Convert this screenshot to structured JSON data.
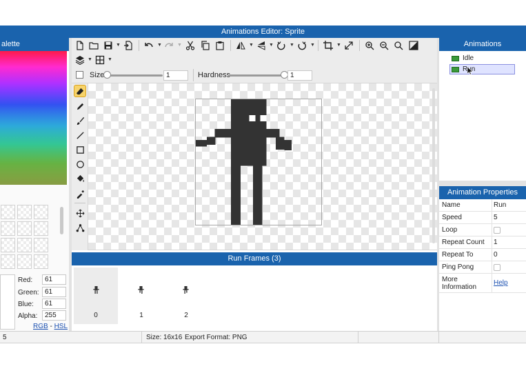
{
  "window": {
    "title": "Animations Editor: Sprite"
  },
  "palette": {
    "title": "alette",
    "red_label": "Red:",
    "red": "61",
    "green_label": "Green:",
    "green": "61",
    "blue_label": "Blue:",
    "blue": "61",
    "alpha_label": "Alpha:",
    "alpha": "255",
    "mode_rgb": "RGB",
    "mode_sep": "-",
    "mode_hsl": "HSL"
  },
  "toolbar": {
    "size_label": "Size",
    "size_value": "1",
    "size_level": 0.0,
    "hardness_label": "Hardness",
    "hardness_value": "1",
    "hardness_level": 1.0
  },
  "canvas": {
    "sprite_color": "#333333"
  },
  "frames": {
    "title": "Run Frames (3)",
    "items": [
      {
        "label": "0"
      },
      {
        "label": "1"
      },
      {
        "label": "2"
      }
    ]
  },
  "animations": {
    "title": "Animations",
    "items": [
      {
        "label": "Idle"
      },
      {
        "label": "Run"
      }
    ]
  },
  "properties": {
    "title": "Animation Properties",
    "name_label": "Name",
    "name_value": "Run",
    "speed_label": "Speed",
    "speed_value": "5",
    "loop_label": "Loop",
    "repeat_count_label": "Repeat Count",
    "repeat_count_value": "1",
    "repeat_to_label": "Repeat To",
    "repeat_to_value": "0",
    "ping_pong_label": "Ping Pong",
    "more_info_label_1": "More",
    "more_info_label_2": "Information",
    "help_link": "Help"
  },
  "status": {
    "left": "5",
    "size": "Size: 16x16",
    "export": "Export Format: PNG"
  },
  "colors": {
    "accent": "#1a63ad",
    "selection": "#dfe3ff"
  }
}
